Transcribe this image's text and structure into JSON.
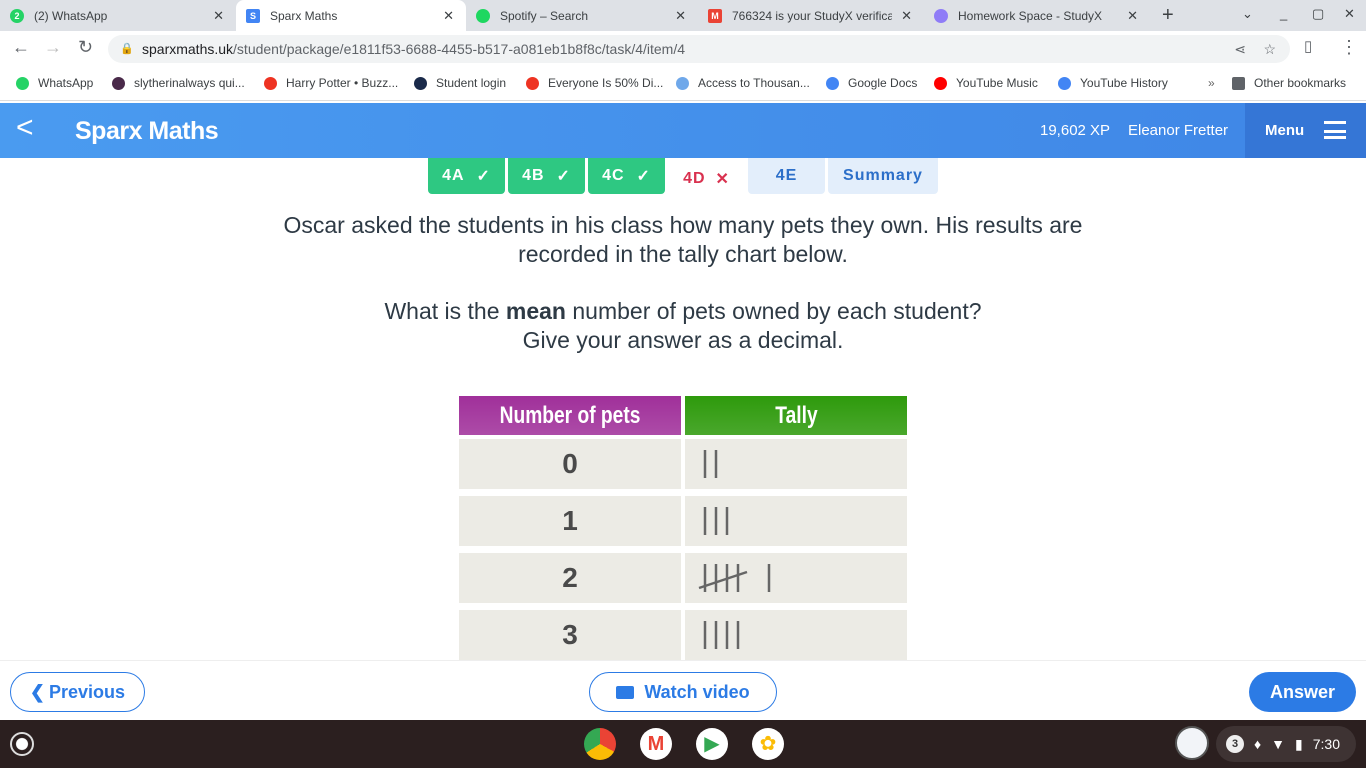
{
  "browser": {
    "tabs": [
      {
        "title": "(2) WhatsApp",
        "badge": "2",
        "color": "#25d366"
      },
      {
        "title": "Sparx Maths",
        "badge": "S",
        "color": "#4285f4",
        "active": true
      },
      {
        "title": "Spotify – Search",
        "badge": "",
        "color": "#1ed760"
      },
      {
        "title": "766324 is your StudyX verifica",
        "badge": "M",
        "color": "#ea4335"
      },
      {
        "title": "Homework Space - StudyX",
        "badge": "",
        "color": "#8f7cf7"
      }
    ],
    "url_domain": "sparxmaths.uk",
    "url_path": "/student/package/e1811f53-6688-4455-b517-a081eb1b8f8c/task/4/item/4",
    "bookmarks": [
      {
        "label": "WhatsApp",
        "color": "#25d366"
      },
      {
        "label": "slytherinalways qui...",
        "color": "#4a2a4a"
      },
      {
        "label": "Harry Potter • Buzz...",
        "color": "#ee3322"
      },
      {
        "label": "Student login",
        "color": "#1a2a4a"
      },
      {
        "label": "Everyone Is 50% Di...",
        "color": "#ee3322"
      },
      {
        "label": "Access to Thousan...",
        "color": "#6fa8ea"
      },
      {
        "label": "Google Docs",
        "color": "#4285f4"
      },
      {
        "label": "YouTube Music",
        "color": "#ff0000"
      },
      {
        "label": "YouTube History",
        "color": "#4285f4"
      }
    ],
    "other_bookmarks": "Other bookmarks"
  },
  "header": {
    "title": "Sparx Maths",
    "xp": "19,602 XP",
    "user": "Eleanor Fretter",
    "menu": "Menu"
  },
  "task_tabs": [
    {
      "label": "4A",
      "status": "correct"
    },
    {
      "label": "4B",
      "status": "correct"
    },
    {
      "label": "4C",
      "status": "correct"
    },
    {
      "label": "4D",
      "status": "wrong"
    },
    {
      "label": "4E",
      "status": "todo"
    },
    {
      "label": "Summary",
      "status": "todo"
    }
  ],
  "question": {
    "line1": "Oscar asked the students in his class how many pets they own. His results are",
    "line2": "recorded in the tally chart below.",
    "line3_pre": "What is the ",
    "line3_bold": "mean",
    "line3_post": " number of pets owned by each student?",
    "line4": "Give your answer as a decimal."
  },
  "table": {
    "headers": [
      "Number of pets",
      "Tally"
    ],
    "header_colors": [
      "#a0309a",
      "#2e9a0c"
    ],
    "rows": [
      {
        "pets": "0",
        "tally": 2
      },
      {
        "pets": "1",
        "tally": 3
      },
      {
        "pets": "2",
        "tally": 6
      },
      {
        "pets": "3",
        "tally": 4
      }
    ]
  },
  "footer": {
    "previous": "Previous",
    "watch": "Watch video",
    "answer": "Answer"
  },
  "system": {
    "notifications": "3",
    "time": "7:30"
  }
}
